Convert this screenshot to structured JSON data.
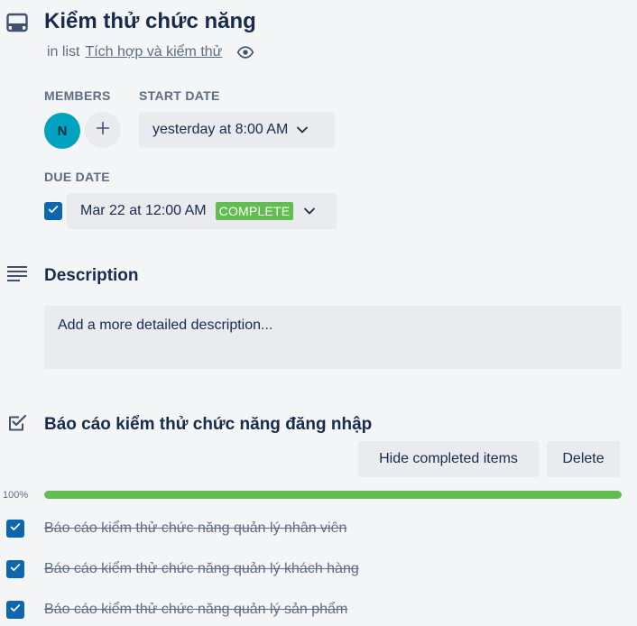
{
  "card": {
    "title": "Kiểm thử chức năng",
    "in_list_prefix": "in list",
    "list_name": "Tích hợp và kiểm thử"
  },
  "members": {
    "label": "MEMBERS",
    "avatar_initial": "N",
    "avatar_color": "#00a3bf"
  },
  "start_date": {
    "label": "START DATE",
    "value": "yesterday at 8:00 AM"
  },
  "due_date": {
    "label": "DUE DATE",
    "value": "Mar 22 at 12:00 AM",
    "badge": "COMPLETE",
    "checked": true
  },
  "description": {
    "title": "Description",
    "placeholder": "Add a more detailed description..."
  },
  "checklist": {
    "title": "Báo cáo kiểm thử chức năng đăng nhập",
    "hide_button": "Hide completed items",
    "delete_button": "Delete",
    "progress_label": "100%",
    "progress": 1.0,
    "items": [
      {
        "text": "Báo cáo kiểm thử chức năng quản lý nhân viên",
        "checked": true
      },
      {
        "text": "Báo cáo kiểm thử chức năng quản lý khách hàng",
        "checked": true
      },
      {
        "text": "Báo cáo kiểm thử chức năng quản lý sản phẩm",
        "checked": true
      }
    ]
  },
  "colors": {
    "accent": "#0c66b0",
    "complete": "#61bd4f",
    "button_bg": "#e9ebee"
  },
  "icons": [
    "card-icon",
    "eye-icon",
    "plus-icon",
    "chevron-down-icon",
    "checkmark-icon",
    "description-icon",
    "checklist-icon"
  ]
}
